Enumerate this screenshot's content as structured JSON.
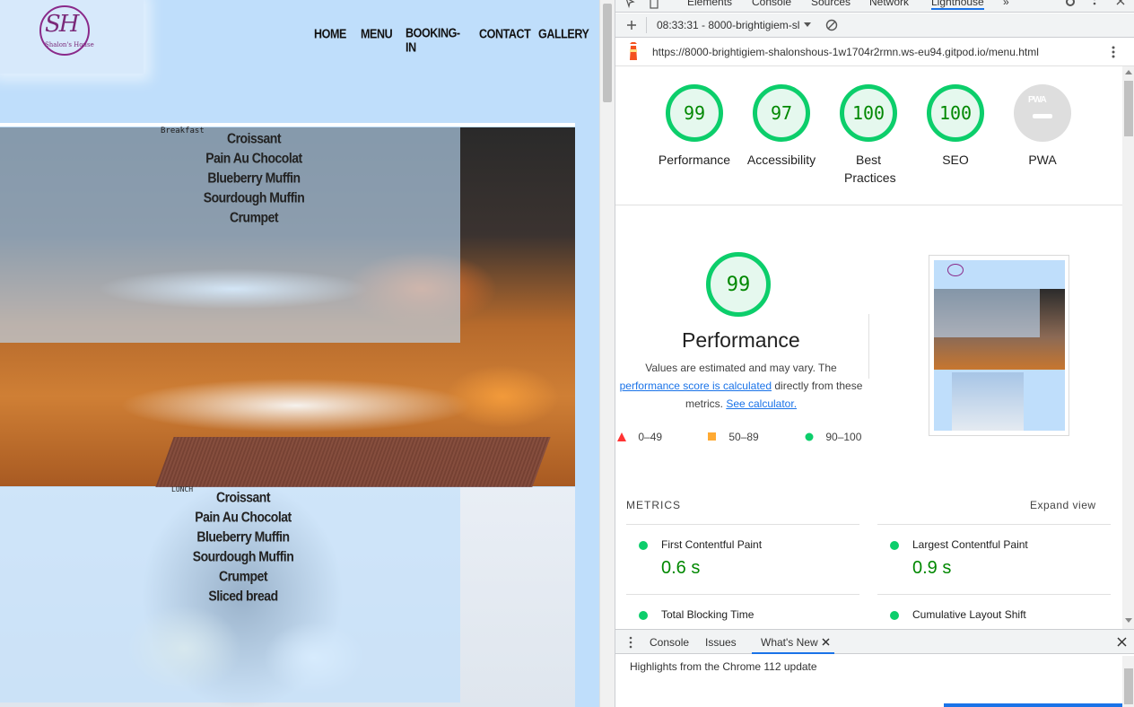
{
  "site": {
    "logo": {
      "monogram": "SH",
      "subtitle": "Shalon's House"
    },
    "nav": [
      "HOME",
      "MENU",
      "BOOKING-IN",
      "CONTACT",
      "GALLERY"
    ],
    "breakfast": {
      "heading": "Breakfast",
      "items": [
        "Croissant",
        "Pain Au Chocolat",
        "Blueberry Muffin",
        "Sourdough Muffin",
        "Crumpet"
      ]
    },
    "lunch": {
      "heading": "LUNCH",
      "items": [
        "Croissant",
        "Pain Au Chocolat",
        "Blueberry Muffin",
        "Sourdough Muffin",
        "Crumpet",
        "Sliced bread"
      ]
    }
  },
  "devtools": {
    "tabs": [
      "Elements",
      "Console",
      "Sources",
      "Network",
      "Lighthouse",
      "»"
    ],
    "report_selector": "08:33:31 - 8000-brightigiem-sl",
    "url": "https://8000-brightigiem-shalonshous-1w1704r2rmn.ws-eu94.gitpod.io/menu.html",
    "scores": [
      {
        "label": "Performance",
        "value": "99"
      },
      {
        "label": "Accessibility",
        "value": "97"
      },
      {
        "label": "Best Practices",
        "value": "100"
      },
      {
        "label": "SEO",
        "value": "100"
      }
    ],
    "pwa": {
      "label": "PWA",
      "badge": "PWA"
    },
    "performance": {
      "score": "99",
      "title": "Performance",
      "desc_1": "Values are estimated and may vary. The",
      "link_1": "performance score is calculated",
      "desc_2": "directly from these metrics.",
      "link_2": "See calculator."
    },
    "legend": [
      {
        "range": "0–49",
        "color": "#ff3333"
      },
      {
        "range": "50–89",
        "color": "#ffaa33"
      },
      {
        "range": "90–100",
        "color": "#0cce6b"
      }
    ],
    "metrics_header": "METRICS",
    "expand_view": "Expand view",
    "metrics": [
      {
        "name": "First Contentful Paint",
        "value": "0.6 s"
      },
      {
        "name": "Largest Contentful Paint",
        "value": "0.9 s"
      },
      {
        "name": "Total Blocking Time",
        "value": ""
      },
      {
        "name": "Cumulative Layout Shift",
        "value": ""
      }
    ],
    "drawer": {
      "tabs": [
        "Console",
        "Issues",
        "What's New"
      ],
      "content": "Highlights from the Chrome 112 update"
    },
    "colors": {
      "pass": "#0cce6b",
      "accent": "#1a73e8"
    }
  }
}
